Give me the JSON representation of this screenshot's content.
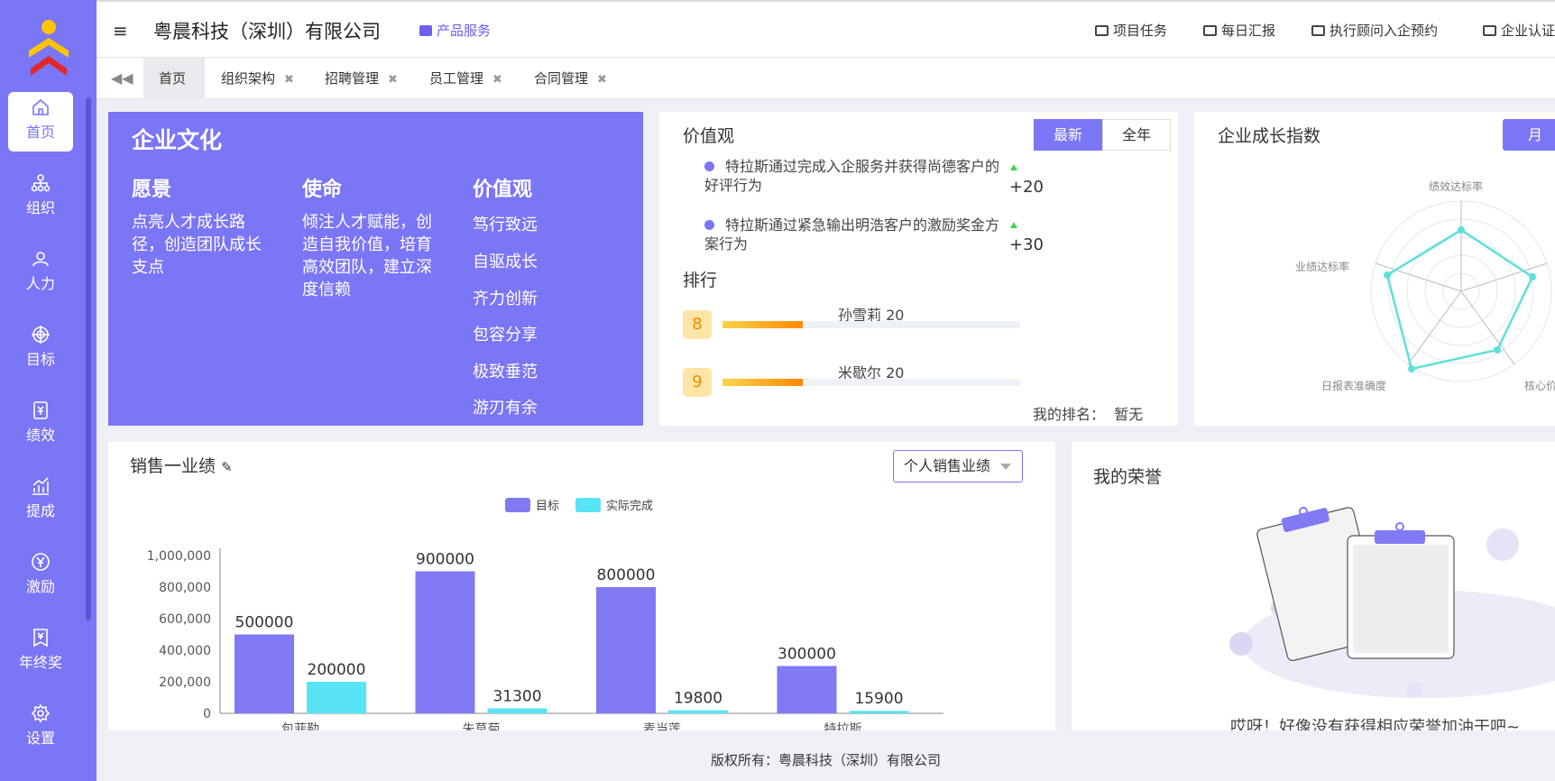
{
  "sidebar": {
    "items": [
      {
        "label": "首页",
        "icon": "home-icon"
      },
      {
        "label": "组织",
        "icon": "org-icon"
      },
      {
        "label": "人力",
        "icon": "people-icon"
      },
      {
        "label": "目标",
        "icon": "target-icon"
      },
      {
        "label": "绩效",
        "icon": "performance-icon"
      },
      {
        "label": "提成",
        "icon": "commission-icon"
      },
      {
        "label": "激励",
        "icon": "incentive-icon"
      },
      {
        "label": "年终奖",
        "icon": "bonus-icon"
      },
      {
        "label": "设置",
        "icon": "gear-icon"
      }
    ]
  },
  "header": {
    "company": "粤晨科技（深圳）有限公司",
    "product": "产品服务",
    "links": [
      "项目任务",
      "每日汇报",
      "执行顾问入企预约",
      "企业认证"
    ]
  },
  "tabs": [
    {
      "label": "首页"
    },
    {
      "label": "组织架构"
    },
    {
      "label": "招聘管理"
    },
    {
      "label": "员工管理"
    },
    {
      "label": "合同管理"
    }
  ],
  "culture": {
    "title": "企业文化",
    "vision_title": "愿景",
    "vision_text": "点亮人才成长路径，创造团队成长支点",
    "mission_title": "使命",
    "mission_text": "倾注人才赋能，创造自我价值，培育高效团队，建立深度信赖",
    "values_title": "价值观",
    "values": [
      "笃行致远",
      "自驱成长",
      "齐力创新",
      "包容分享",
      "极致垂范",
      "游刃有余"
    ]
  },
  "values_panel": {
    "title": "价值观",
    "seg_new": "最新",
    "seg_year": "全年",
    "items": [
      {
        "text": "特拉斯通过完成入企服务并获得尚德客户的好评行为",
        "points": "+20"
      },
      {
        "text": "特拉斯通过紧急输出明浩客户的激励奖金方案行为",
        "points": "+30"
      }
    ],
    "rank_title": "排行",
    "ranks": [
      {
        "rank": "8",
        "name": "孙雪莉 20",
        "fill": 0.27
      },
      {
        "rank": "9",
        "name": "米歇尔 20",
        "fill": 0.27
      }
    ],
    "my_rank_label": "我的排名：",
    "my_rank_value": "暂无"
  },
  "growth": {
    "title": "企业成长指数",
    "period_button": "月",
    "labels": [
      "绩效达标率",
      "业绩达标率",
      "日报表准确度",
      "核心价"
    ],
    "color": "#5ee0d8"
  },
  "sales": {
    "title": "销售一业绩",
    "select_value": "个人销售业绩",
    "legend": [
      "目标",
      "实际完成"
    ]
  },
  "chart_data": {
    "type": "bar",
    "categories": [
      "包菲勒",
      "朱莫菊",
      "麦当莲",
      "特拉斯"
    ],
    "series": [
      {
        "name": "目标",
        "values": [
          500000,
          900000,
          800000,
          300000
        ],
        "color": "#8279f5"
      },
      {
        "name": "实际完成",
        "values": [
          200000,
          31300,
          19800,
          15900
        ],
        "color": "#58e4f6"
      }
    ],
    "ylim": [
      0,
      1000000
    ],
    "yticks": [
      "0",
      "200,000",
      "400,000",
      "600,000",
      "800,000",
      "1,000,000"
    ],
    "ytick_values": [
      0,
      200000,
      400000,
      600000,
      800000,
      1000000
    ]
  },
  "honor": {
    "title": "我的荣誉",
    "message": "哎呀！好像没有获得相应荣誉加油干吧~"
  },
  "footer": {
    "copyright": "版权所有：粤晨科技（深圳）有限公司"
  }
}
